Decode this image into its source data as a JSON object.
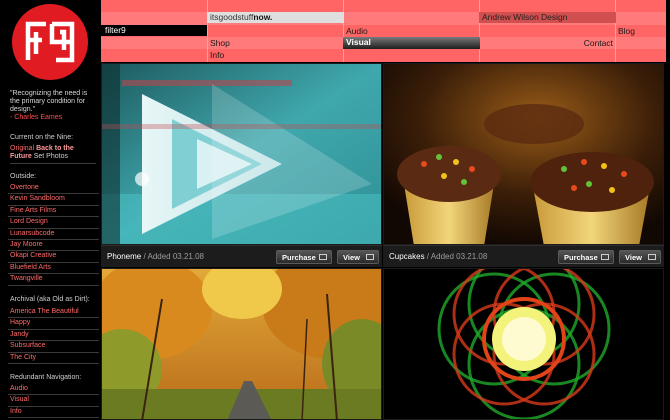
{
  "site": {
    "logo_text": "filter9",
    "brand_prefix": "itsgoodstuff",
    "brand_suffix": "now."
  },
  "nav": {
    "author": "Andrew Wilson Design",
    "audio": "Audio",
    "blog": "Blog",
    "shop": "Shop",
    "visual": "Visual",
    "contact": "Contact",
    "info": "Info"
  },
  "sidebar": {
    "quote": "\"Recognizing the need is the primary condition for design.\"",
    "quote_attr": "- Charles Eames",
    "current_heading": "Current on the Nine:",
    "current_prefix": "Original ",
    "current_bold": "Back to the Future",
    "current_suffix": " Set Photos",
    "outside_heading": "Outside:",
    "outside_items": [
      "Overtone",
      "Kevin Sandbloom",
      "Fine Arts Films",
      "Lord Design",
      "Lunarsubcode",
      "Jay Moore",
      "Okapi Creative",
      "Bluefield Arts",
      "Twangville"
    ],
    "archival_heading": "Archival (aka Old as Dirt):",
    "archival_items": [
      "America The Beautiful",
      "Happy",
      "Jandy",
      "Subsurface",
      "The City"
    ],
    "redundant_heading": "Redundant Navigation:",
    "redundant_items": [
      "Audio",
      "Visual",
      "Info"
    ]
  },
  "gallery": {
    "items": [
      {
        "title": "Phoneme",
        "added": " / Added 03.21.08",
        "purchase": "Purchase",
        "view": "View"
      },
      {
        "title": "Cupcakes",
        "added": " / Added 03.21.08",
        "purchase": "Purchase",
        "view": "View"
      }
    ]
  },
  "colors": {
    "brand_red": "#e11b22",
    "nav_pink": "#ff7a7a",
    "link_red": "#ff6a6a"
  }
}
